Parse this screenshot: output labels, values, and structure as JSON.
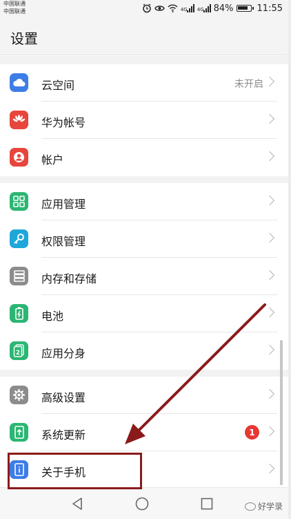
{
  "status_bar": {
    "carrier_1": "中国联通",
    "carrier_2": "中国联通",
    "network_1": "4G",
    "network_2": "4G",
    "battery_percent": "84%",
    "battery_level": 0.84,
    "time": "11:55",
    "icons": [
      "alarm-icon",
      "eye-icon",
      "wifi-icon",
      "signal-icon",
      "signal-icon",
      "battery-icon"
    ]
  },
  "header": {
    "title": "设置"
  },
  "sections": [
    {
      "items": [
        {
          "label": "云空间",
          "value": "未开启",
          "icon": "cloud-icon",
          "color": "#3d7de6"
        },
        {
          "label": "华为帐号",
          "value": "",
          "icon": "huawei-logo-icon",
          "color": "#e8453c"
        },
        {
          "label": "帐户",
          "value": "",
          "icon": "account-icon",
          "color": "#e8453c"
        }
      ]
    },
    {
      "items": [
        {
          "label": "应用管理",
          "value": "",
          "icon": "apps-grid-icon",
          "color": "#2bb673"
        },
        {
          "label": "权限管理",
          "value": "",
          "icon": "key-icon",
          "color": "#1ea7d8"
        },
        {
          "label": "内存和存储",
          "value": "",
          "icon": "storage-icon",
          "color": "#8c8c8c"
        },
        {
          "label": "电池",
          "value": "",
          "icon": "battery-icon",
          "color": "#2bb673"
        },
        {
          "label": "应用分身",
          "value": "",
          "icon": "app-twin-icon",
          "color": "#2bb673"
        }
      ]
    },
    {
      "items": [
        {
          "label": "高级设置",
          "value": "",
          "icon": "gear-icon",
          "color": "#8c8c8c"
        },
        {
          "label": "系统更新",
          "value": "",
          "badge": "1",
          "icon": "system-update-icon",
          "color": "#2bb673"
        },
        {
          "label": "关于手机",
          "value": "",
          "icon": "phone-info-icon",
          "color": "#3d7de6"
        }
      ]
    }
  ],
  "nav_bar": {
    "icons": [
      "back-icon",
      "home-icon",
      "recents-icon"
    ]
  },
  "watermark": {
    "text": "好学录"
  },
  "annotation": {
    "color": "#8b1a1a"
  }
}
